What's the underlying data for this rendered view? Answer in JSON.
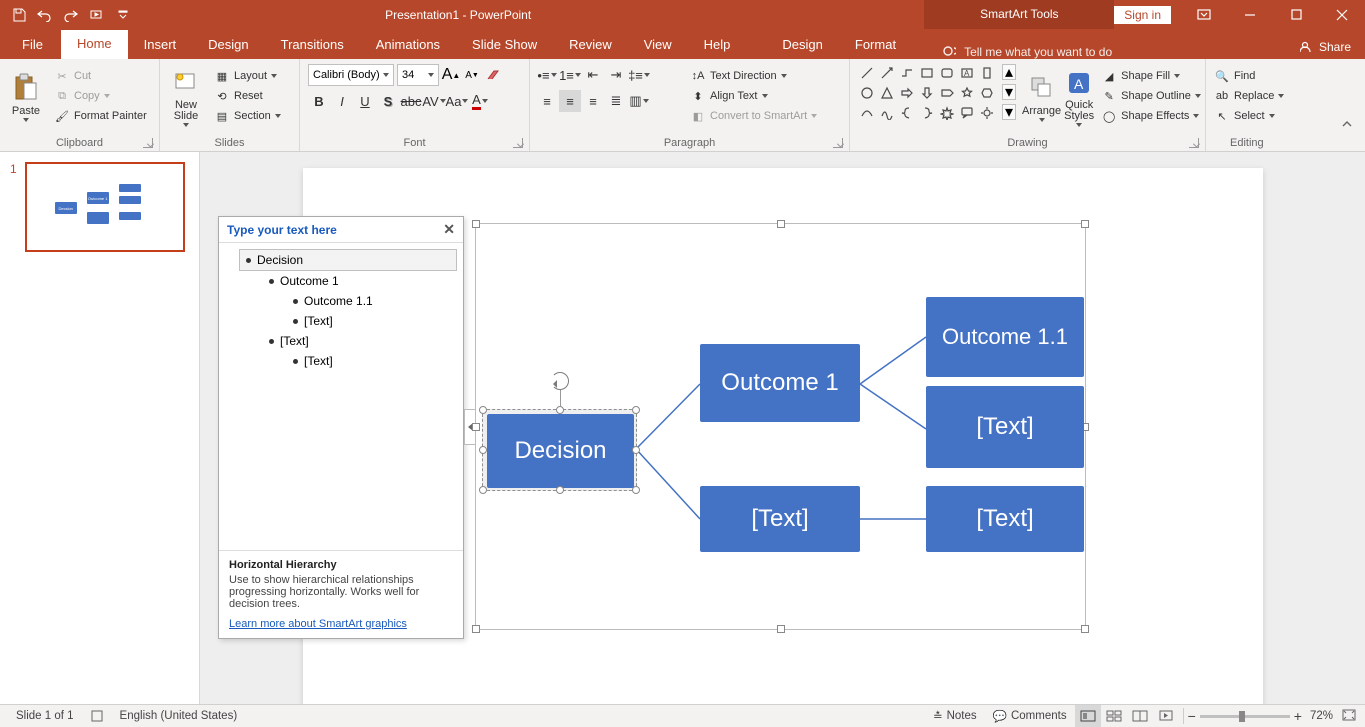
{
  "titlebar": {
    "title": "Presentation1 - PowerPoint",
    "smartart_tools": "SmartArt Tools",
    "signin": "Sign in"
  },
  "tabs": {
    "file": "File",
    "home": "Home",
    "insert": "Insert",
    "design": "Design",
    "transitions": "Transitions",
    "animations": "Animations",
    "slideshow": "Slide Show",
    "review": "Review",
    "view": "View",
    "help": "Help",
    "sa_design": "Design",
    "sa_format": "Format",
    "tellme": "Tell me what you want to do",
    "share": "Share"
  },
  "ribbon": {
    "clipboard": {
      "label": "Clipboard",
      "paste": "Paste",
      "cut": "Cut",
      "copy": "Copy",
      "format_painter": "Format Painter"
    },
    "slides": {
      "label": "Slides",
      "new_slide": "New\nSlide",
      "layout": "Layout",
      "reset": "Reset",
      "section": "Section"
    },
    "font": {
      "label": "Font",
      "name": "Calibri (Body)",
      "size": "34"
    },
    "paragraph": {
      "label": "Paragraph",
      "text_direction": "Text Direction",
      "align_text": "Align Text",
      "convert_smartart": "Convert to SmartArt"
    },
    "drawing": {
      "label": "Drawing",
      "arrange": "Arrange",
      "quick_styles": "Quick\nStyles",
      "shape_fill": "Shape Fill",
      "shape_outline": "Shape Outline",
      "shape_effects": "Shape Effects"
    },
    "editing": {
      "label": "Editing",
      "find": "Find",
      "replace": "Replace",
      "select": "Select"
    }
  },
  "textpane": {
    "header": "Type your text here",
    "items": [
      "Decision",
      "Outcome 1",
      "Outcome 1.1",
      "[Text]",
      "[Text]",
      "[Text]"
    ],
    "indents": [
      0,
      1,
      2,
      2,
      1,
      2
    ],
    "footer_title": "Horizontal Hierarchy",
    "footer_desc": "Use to show hierarchical relationships progressing horizontally. Works well for decision trees.",
    "footer_link": "Learn more about SmartArt graphics"
  },
  "smartart": {
    "root": "Decision",
    "l2a": "Outcome 1",
    "l2b": "[Text]",
    "l3a": "Outcome 1.1",
    "l3b": "[Text]",
    "l3c": "[Text]"
  },
  "status": {
    "slide": "Slide 1 of 1",
    "language": "English (United States)",
    "notes": "Notes",
    "comments": "Comments",
    "zoom": "72%"
  },
  "thumb": {
    "num": "1"
  }
}
